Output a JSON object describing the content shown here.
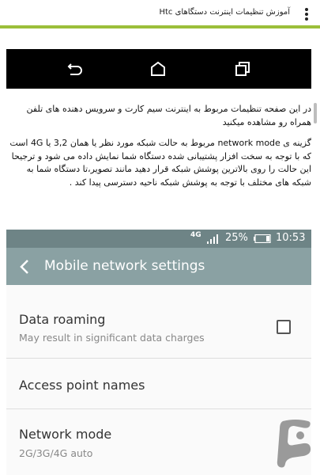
{
  "appbar": {
    "title": "آموزش تنظیمات اینترنت دستگاهای Htc",
    "menu_icon": "more-vert-icon"
  },
  "nav_screenshot": {
    "icons": [
      "back-icon",
      "home-icon",
      "recent-apps-icon"
    ]
  },
  "article": {
    "paragraph_1": "در این صفحه تنظیمات مربوط به اینترنت سیم کارت و سرویس دهنده های تلفن همراه رو مشاهده میکنید",
    "paragraph_2": "گزینه ی network mode مربوط به حالت شبکه مورد نظر یا همان 3,2 یا 4G است که با توجه به سخت افزار پشتیبانی شده دستگاه شما نمایش داده می شود و ترجیحا این حالت را روی بالاترین پوشش شبکه قرار دهید مانند تصویر،تا دستگاه شما به شبکه های مختلف با توجه به پوشش شبکه ناحیه دسترسی پیدا کند ."
  },
  "phone": {
    "status": {
      "network_type": "4G",
      "battery": "25%",
      "time": "10:53"
    },
    "toolbar_title": "Mobile network settings",
    "settings": [
      {
        "title": "Data roaming",
        "subtitle": "May result in significant data charges",
        "checked": false
      },
      {
        "title": "Access point names",
        "subtitle": ""
      },
      {
        "title": "Network mode",
        "subtitle": "2G/3G/4G auto"
      }
    ]
  },
  "colors": {
    "appbar_accent": "#9bbf3a",
    "phone_status_bar": "#6e8486",
    "phone_toolbar": "#8aa1a3",
    "logo": "#9a9a9a"
  }
}
